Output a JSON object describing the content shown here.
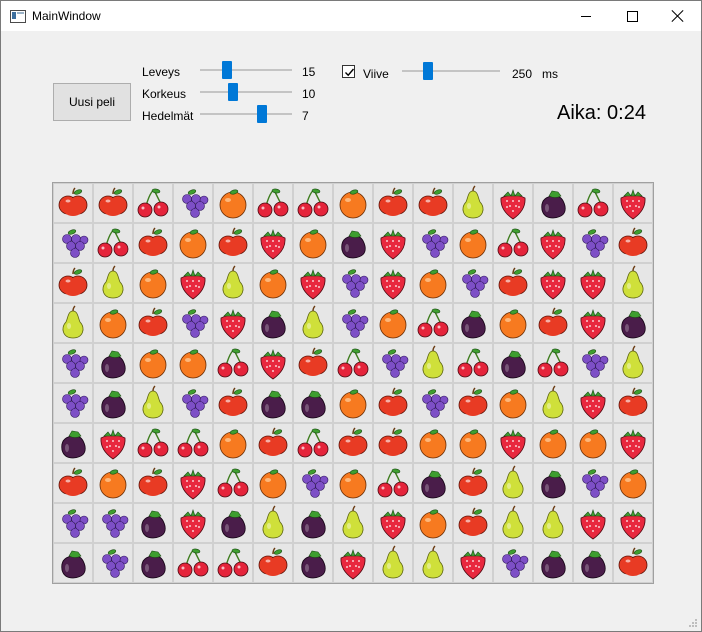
{
  "window": {
    "title": "MainWindow"
  },
  "controls": {
    "new_game_label": "Uusi peli",
    "width_label": "Leveys",
    "width_value": 15,
    "height_label": "Korkeus",
    "height_value": 10,
    "fruits_label": "Hedelmät",
    "fruits_value": 7,
    "delay_label": "Viive",
    "delay_checked": true,
    "delay_value": 250,
    "delay_unit": "ms",
    "slider_levels": {
      "width": 0.27,
      "height": 0.34,
      "fruits": 0.69,
      "delay": 0.24
    }
  },
  "timer": {
    "text": "Aika: 0:24"
  },
  "colors": {
    "apple": "#e83b24",
    "orange": "#f77a20",
    "cherry": "#e5243b",
    "grape": "#7d4fc6",
    "pear": "#cfe03a",
    "strawberry": "#e8283e",
    "eggplant": "#4a1d4a",
    "accent": "#0078d7"
  },
  "board": {
    "columns": 15,
    "rows": 10,
    "fruit_icons": {
      "A": "apple-icon",
      "O": "orange-icon",
      "C": "cherry-icon",
      "G": "grape-icon",
      "P": "pear-icon",
      "S": "strawberry-icon",
      "E": "eggplant-icon"
    },
    "cells": [
      [
        "A",
        "A",
        "C",
        "G",
        "O",
        "C",
        "C",
        "O",
        "A",
        "A",
        "P",
        "S",
        "E",
        "C",
        "S"
      ],
      [
        "G",
        "C",
        "A",
        "O",
        "A",
        "S",
        "O",
        "E",
        "S",
        "G",
        "O",
        "C",
        "S",
        "G",
        "A"
      ],
      [
        "A",
        "P",
        "O",
        "S",
        "P",
        "O",
        "S",
        "G",
        "S",
        "O",
        "G",
        "A",
        "S",
        "S",
        "P"
      ],
      [
        "P",
        "O",
        "A",
        "G",
        "S",
        "E",
        "P",
        "G",
        "O",
        "C",
        "E",
        "O",
        "A",
        "S",
        "E"
      ],
      [
        "G",
        "E",
        "O",
        "O",
        "C",
        "S",
        "A",
        "C",
        "G",
        "P",
        "C",
        "E",
        "C",
        "G",
        "P"
      ],
      [
        "G",
        "E",
        "P",
        "G",
        "A",
        "E",
        "E",
        "O",
        "A",
        "G",
        "A",
        "O",
        "P",
        "S",
        "A"
      ],
      [
        "E",
        "S",
        "C",
        "C",
        "O",
        "A",
        "C",
        "A",
        "A",
        "O",
        "O",
        "S",
        "O",
        "O",
        "S"
      ],
      [
        "A",
        "O",
        "A",
        "S",
        "C",
        "O",
        "G",
        "O",
        "C",
        "E",
        "A",
        "P",
        "E",
        "G",
        "O"
      ],
      [
        "G",
        "G",
        "E",
        "S",
        "E",
        "P",
        "E",
        "P",
        "S",
        "O",
        "A",
        "P",
        "P",
        "S",
        "S"
      ],
      [
        "E",
        "G",
        "E",
        "C",
        "C",
        "A",
        "E",
        "S",
        "P",
        "P",
        "S",
        "G",
        "E",
        "E",
        "A"
      ]
    ]
  }
}
